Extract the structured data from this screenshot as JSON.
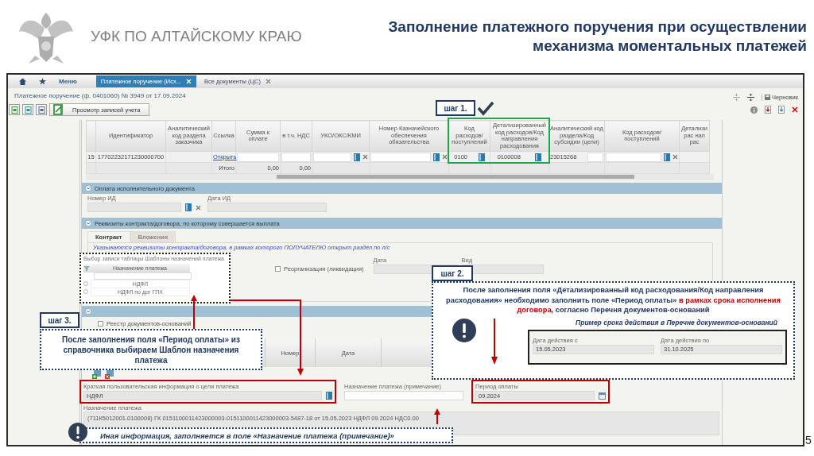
{
  "slide": {
    "organization": "УФК ПО АЛТАЙСКОМУ КРАЮ",
    "title_lines": [
      "Заполнение платежного поручения при осуществлении",
      "механизма моментальных платежей"
    ],
    "page_number": "5"
  },
  "nav": {
    "menu": "Меню",
    "tabs": [
      {
        "label": "Платежное поручение (Исх...",
        "selected": true
      },
      {
        "label": "Все документы (ЦС)",
        "selected": false
      }
    ]
  },
  "document_title": "Платежное поручение (ф. 0401060) № 3949 от 17.09.2024",
  "toolbar": {
    "view_button": "Просмотр записей учета"
  },
  "status": {
    "draft": "Черновик"
  },
  "table": {
    "columns": [
      "",
      "Идентификатор",
      "Аналитический код раздела заказчика",
      "Ссылка",
      "Сумма к оплате",
      "в т.ч. НДС",
      "УКО/ОКС/КМИ",
      "Номер Казначейского обеспечения обязательства",
      "Код расходов/ поступлений",
      "Детализированный код расходов/Код направления расходования",
      "Аналитический код раздела/Код субсидии (цели)",
      "Код расходов/ поступлений",
      "Детализи рас нап рас"
    ],
    "rows": [
      {
        "cells": [
          {
            "kind": "text",
            "text": "15"
          },
          {
            "kind": "text",
            "text": "17702232171230000700"
          },
          {
            "kind": "empty"
          },
          {
            "kind": "link",
            "text": "Открыть"
          },
          {
            "kind": "input"
          },
          {
            "kind": "input"
          },
          {
            "kind": "lookup"
          },
          {
            "kind": "lookup"
          },
          {
            "kind": "value_book",
            "text": "0100"
          },
          {
            "kind": "value_book",
            "text": "0100008"
          },
          {
            "kind": "value_input",
            "text": "23015268"
          },
          {
            "kind": "lookup"
          },
          {
            "kind": "empty"
          }
        ]
      }
    ],
    "total": {
      "label": "Итого",
      "values": [
        "0,00",
        "0,00"
      ]
    }
  },
  "executive_document": {
    "title": "Оплата исполнительного документа",
    "expanded": true,
    "fields": [
      {
        "label": "Номер ИД",
        "kind": "lookup"
      },
      {
        "label": "Дата ИД",
        "kind": "text"
      }
    ]
  },
  "contract": {
    "title": "Реквизиты контракта/договора, по которому совершается выплата",
    "expanded": true,
    "tabs": [
      {
        "label": "Контракт",
        "selected": true
      },
      {
        "label": "Вложения",
        "selected": false
      }
    ],
    "note": "Указываются реквизиты контракта/договора, в рамках которого ПОЛУЧАТЕЛЮ открыт раздел по л/с",
    "reorganization": {
      "label": "Реорганизация (ликвидация)",
      "checked": false
    },
    "fields": [
      {
        "label": "Дата",
        "kind": "text"
      },
      {
        "label": "Вид",
        "kind": "text"
      }
    ]
  },
  "basis_documents": {
    "expanded": true,
    "registry": {
      "label": "Реестр документов-оснований",
      "checked": false
    },
    "columns": [
      "Номер",
      "Дата"
    ]
  },
  "payment": {
    "fields": [
      {
        "label": "Краткая пользовательская информация о цели платежа",
        "value": "НДФЛ",
        "kind": "book",
        "highlighted": true
      },
      {
        "label": "Назначение платежа (примечание)",
        "kind": "text",
        "highlighted": false
      },
      {
        "label": "Период оплаты",
        "value": "09.2024",
        "kind": "date",
        "highlighted": true
      }
    ],
    "purpose": {
      "label": "Назначение платежа",
      "value": "(711К5012001.0100008) ГК 0151100011423000003-0151100011423000003-5487-18 от 15.05.2023 НДФЛ 09.2024 НДС0.00"
    }
  },
  "template_popup": {
    "title": "Выбор записи таблицы Шаблоны назначений платежа",
    "column": "Назначение платежа",
    "rows": [
      {
        "text": "НДФЛ",
        "selected": false
      },
      {
        "text": "НДФЛ по дог ГПХ",
        "selected": false
      }
    ]
  },
  "steps": [
    {
      "label": "шаг 1."
    },
    {
      "label": "шаг 2."
    },
    {
      "label": "шаг 3."
    }
  ],
  "callout_period": {
    "parts": [
      {
        "text": "После заполнения поля «Детализированный код расходования/Код направления расходования» необходимо заполнить поле «Период оплаты» ",
        "emphasis": false
      },
      {
        "text": "в рамках срока исполнения договора",
        "emphasis": true
      },
      {
        "text": ", согласно Перечня документов-оснований",
        "emphasis": false
      }
    ],
    "example_title": "Пример срока действия в Перечне документов-оснований",
    "example_fields": [
      {
        "label": "Дата действия с",
        "value": "15.05.2023"
      },
      {
        "label": "Дата действия по",
        "value": "31.10.2025"
      }
    ]
  },
  "callout_template": "После заполнения поля «Период оплаты» из справочника выбираем Шаблон назначения платежа",
  "note_other": "Иная информация, заполняется в поле «Назначение платежа (примечание)»"
}
